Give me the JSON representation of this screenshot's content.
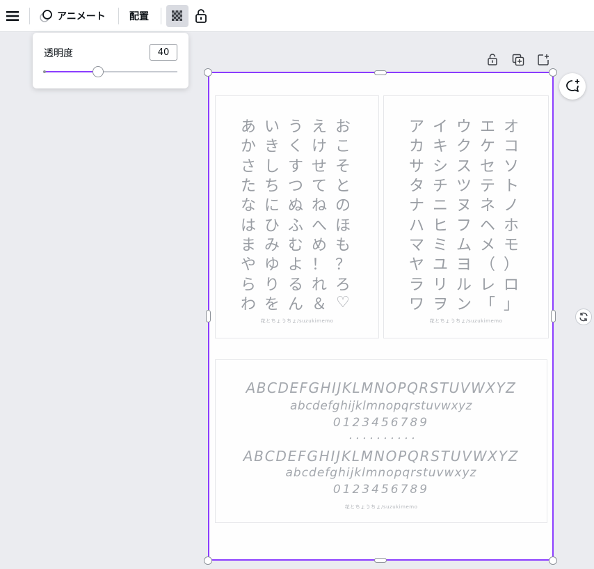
{
  "toolbar": {
    "animate_label": "アニメート",
    "arrange_label": "配置"
  },
  "transparency_popup": {
    "label": "透明度",
    "value": "40",
    "slider_fraction": 0.4
  },
  "document": {
    "hiragana": [
      "あ",
      "い",
      "う",
      "え",
      "お",
      "か",
      "き",
      "く",
      "け",
      "こ",
      "さ",
      "し",
      "す",
      "せ",
      "そ",
      "た",
      "ち",
      "つ",
      "て",
      "と",
      "な",
      "に",
      "ぬ",
      "ね",
      "の",
      "は",
      "ひ",
      "ふ",
      "へ",
      "ほ",
      "ま",
      "み",
      "む",
      "め",
      "も",
      "や",
      "ゆ",
      "よ",
      "！",
      "？",
      "ら",
      "り",
      "る",
      "れ",
      "ろ",
      "わ",
      "を",
      "ん",
      "＆",
      "♡"
    ],
    "katakana": [
      "ア",
      "イ",
      "ウ",
      "エ",
      "オ",
      "カ",
      "キ",
      "ク",
      "ケ",
      "コ",
      "サ",
      "シ",
      "ス",
      "セ",
      "ソ",
      "タ",
      "チ",
      "ツ",
      "テ",
      "ト",
      "ナ",
      "ニ",
      "ヌ",
      "ネ",
      "ノ",
      "ハ",
      "ヒ",
      "フ",
      "ヘ",
      "ホ",
      "マ",
      "ミ",
      "ム",
      "メ",
      "モ",
      "ヤ",
      "ユ",
      "ヨ",
      "（",
      "）",
      "ラ",
      "リ",
      "ル",
      "レ",
      "ロ",
      "ワ",
      "ヲ",
      "ン",
      "「",
      "」"
    ],
    "credit": "花とちょうちょ/suzukimemo",
    "latin": {
      "upper": "ABCDEFGHIJKLMNOPQRSTUVWXYZ",
      "lower": "abcdefghijklmnopqrstuvwxyz",
      "digits": "0123456789",
      "dots": "・・・・・・・・・・"
    }
  },
  "colors": {
    "accent": "#8b3dff",
    "toolbar_bg": "#ffffff",
    "canvas_bg": "#ebecf0",
    "glyph": "#9a9ea4"
  },
  "icons": {
    "menu": "hamburger-menu-icon",
    "animate": "animate-icon",
    "transparency": "transparency-icon",
    "lock": "lock-icon",
    "page_lock": "page-lock-icon",
    "duplicate": "duplicate-page-icon",
    "add_page": "add-page-icon",
    "comment": "add-comment-icon",
    "rotate": "rotate-icon"
  }
}
